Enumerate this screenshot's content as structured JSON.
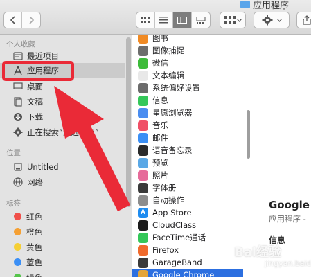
{
  "window": {
    "title": "应用程序"
  },
  "toolbar": {
    "back_icon": "chevron-left-icon",
    "forward_icon": "chevron-right-icon",
    "views": [
      "icon-view-icon",
      "list-view-icon",
      "column-view-icon",
      "gallery-view-icon"
    ],
    "active_view": "column-view-icon"
  },
  "sidebar": {
    "favorites_header": "个人收藏",
    "favorites": [
      {
        "label": "最近项目",
        "icon": "recents-icon"
      },
      {
        "label": "应用程序",
        "icon": "applications-icon",
        "selected": true
      },
      {
        "label": "桌面",
        "icon": "desktop-icon"
      },
      {
        "label": "文稿",
        "icon": "documents-icon"
      },
      {
        "label": "下载",
        "icon": "downloads-icon"
      },
      {
        "label": "正在搜索“最近使用”",
        "icon": "gear-icon"
      }
    ],
    "locations_header": "位置",
    "locations": [
      {
        "label": "Untitled",
        "icon": "disk-icon"
      },
      {
        "label": "网络",
        "icon": "globe-icon"
      }
    ],
    "tags_header": "标签",
    "tags": [
      {
        "label": "红色",
        "color": "#f0504a"
      },
      {
        "label": "橙色",
        "color": "#f5a033"
      },
      {
        "label": "黄色",
        "color": "#f5cf35"
      },
      {
        "label": "蓝色",
        "color": "#3b8ff5"
      },
      {
        "label": "绿色",
        "color": "#55c44b"
      }
    ]
  },
  "files": [
    {
      "label": "图书",
      "color": "#f08a24",
      "glyph": ""
    },
    {
      "label": "图像捕捉",
      "color": "#6d6d6d",
      "glyph": ""
    },
    {
      "label": "微信",
      "color": "#3dbb3a",
      "glyph": ""
    },
    {
      "label": "文本编辑",
      "color": "#e8e8e8",
      "glyph": ""
    },
    {
      "label": "系统偏好设置",
      "color": "#6b6b6b",
      "glyph": ""
    },
    {
      "label": "信息",
      "color": "#34c759",
      "glyph": ""
    },
    {
      "label": "星愿浏览器",
      "color": "#4a8df0",
      "glyph": ""
    },
    {
      "label": "音乐",
      "color": "#f04f66",
      "glyph": ""
    },
    {
      "label": "邮件",
      "color": "#3b8ff5",
      "glyph": ""
    },
    {
      "label": "语音备忘录",
      "color": "#2b2b2b",
      "glyph": ""
    },
    {
      "label": "预览",
      "color": "#5aa8e6",
      "glyph": ""
    },
    {
      "label": "照片",
      "color": "#e66b9a",
      "glyph": ""
    },
    {
      "label": "字体册",
      "color": "#3a3a3a",
      "glyph": ""
    },
    {
      "label": "自动操作",
      "color": "#8d8d8d",
      "glyph": ""
    },
    {
      "label": "App Store",
      "color": "#1e8cf0",
      "glyph": "A"
    },
    {
      "label": "CloudClass",
      "color": "#1c1c1c",
      "glyph": ""
    },
    {
      "label": "FaceTime通话",
      "color": "#34c759",
      "glyph": ""
    },
    {
      "label": "Firefox",
      "color": "#f06a2c",
      "glyph": ""
    },
    {
      "label": "GarageBand",
      "color": "#3a3a3a",
      "glyph": ""
    },
    {
      "label": "Google Chrome",
      "color": "#e4a53a",
      "glyph": "",
      "selected": true
    }
  ],
  "preview": {
    "title": "Google C",
    "subtitle": "应用程序 -",
    "info_label": "信息"
  },
  "annotation": {
    "color": "#ea2a37"
  },
  "watermark": {
    "main": "Bai经验",
    "sub": "jingyan.baidu.com"
  }
}
